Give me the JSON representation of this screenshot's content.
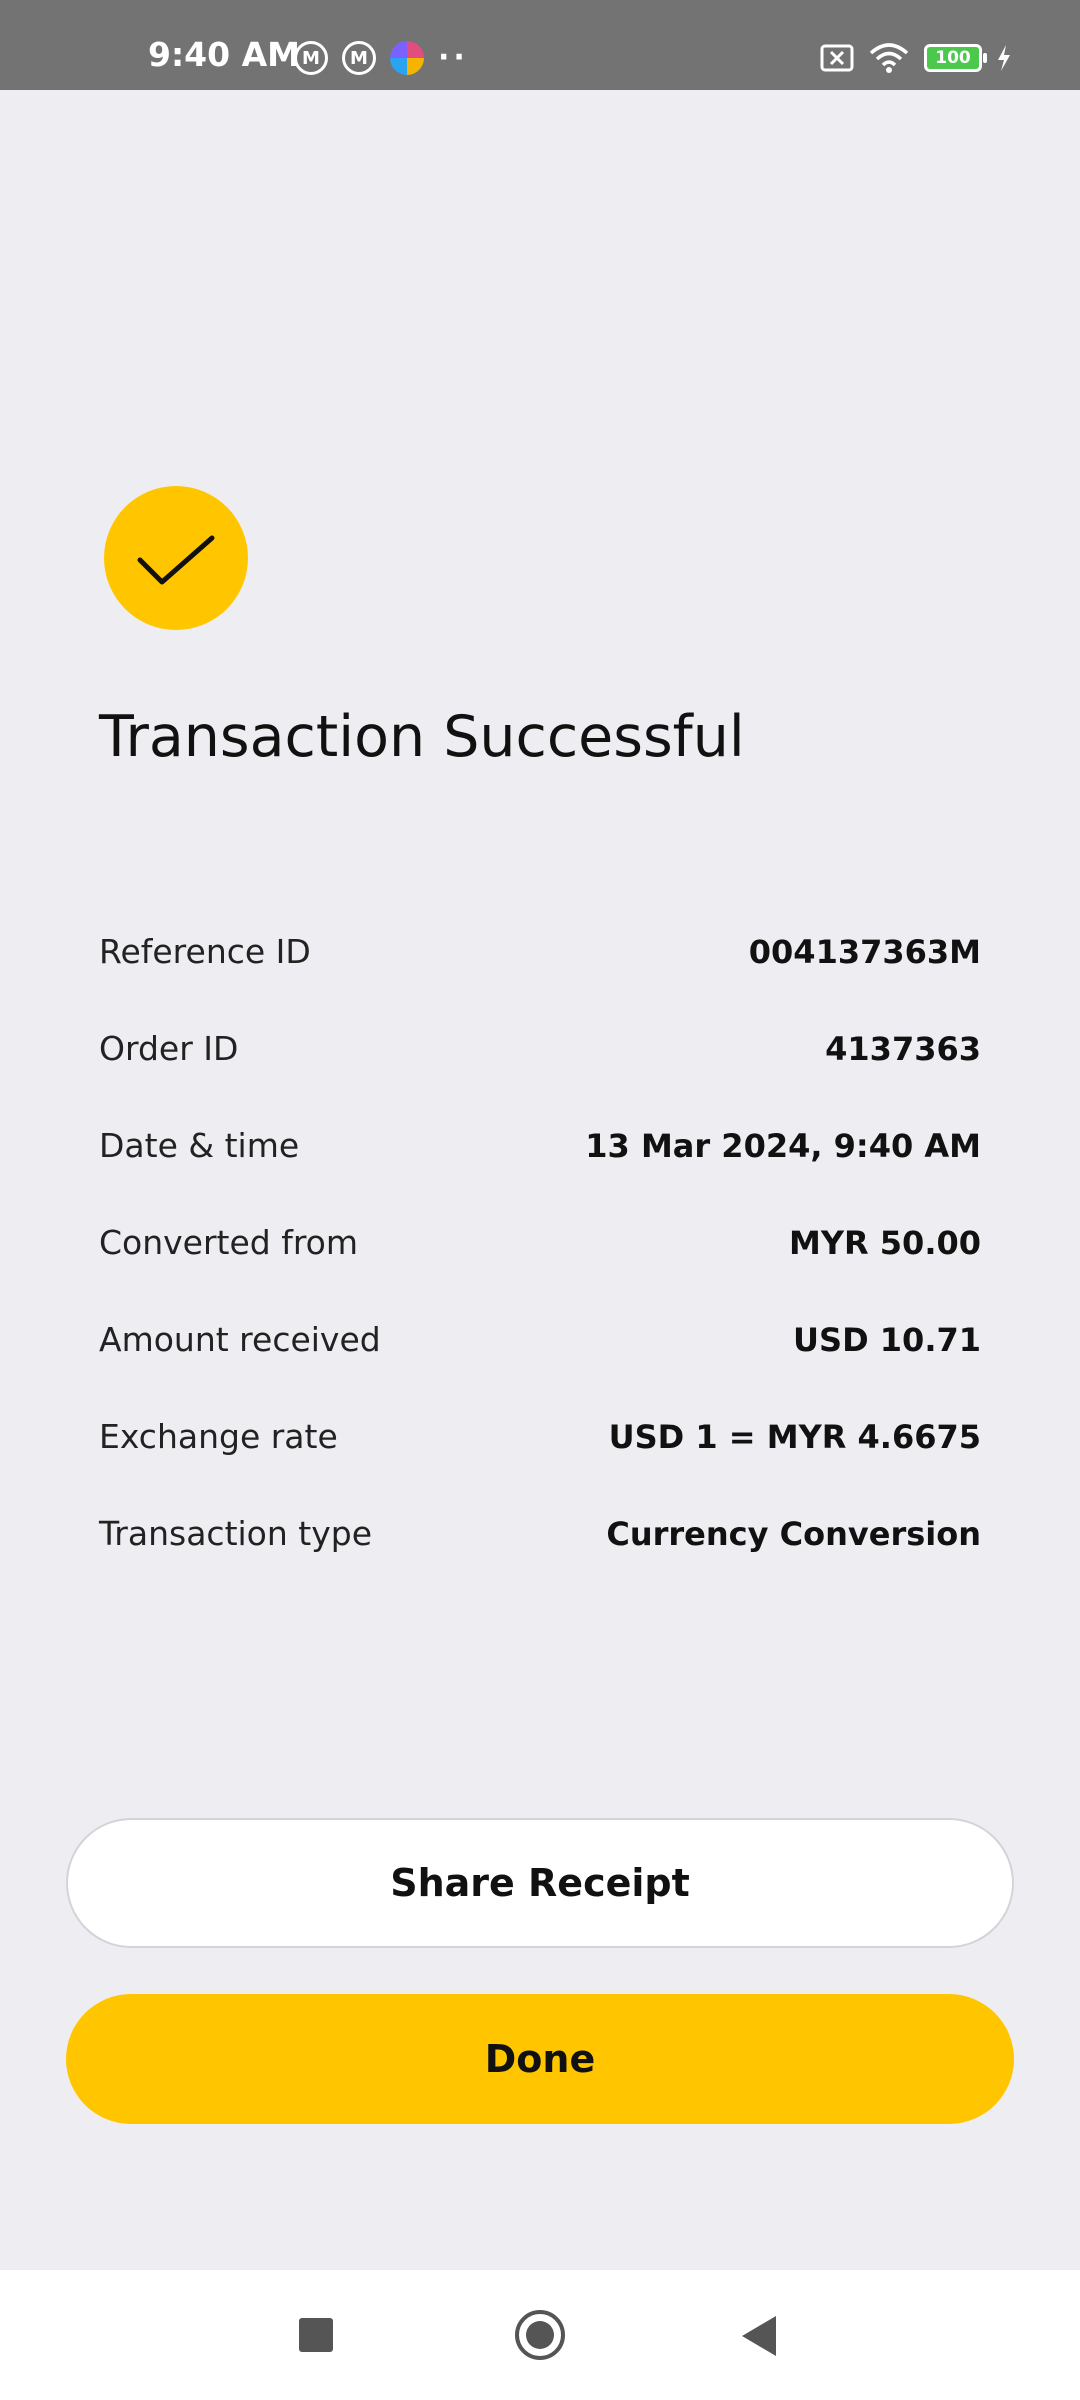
{
  "status_bar": {
    "time": "9:40 AM",
    "notification_icons": [
      "m-icon",
      "m-icon",
      "color-app-icon"
    ],
    "more_dots": "··",
    "battery_level": "100",
    "icons": [
      "sim-off-icon",
      "wifi-icon",
      "battery-icon",
      "charging-icon"
    ]
  },
  "result": {
    "icon": "check-icon",
    "title": "Transaction Successful"
  },
  "details": [
    {
      "label": "Reference ID",
      "value": "004137363M"
    },
    {
      "label": "Order ID",
      "value": "4137363"
    },
    {
      "label": "Date & time",
      "value": "13 Mar 2024, 9:40 AM"
    },
    {
      "label": "Converted from",
      "value": "MYR 50.00"
    },
    {
      "label": "Amount received",
      "value": "USD 10.71"
    },
    {
      "label": "Exchange rate",
      "value": "USD 1 = MYR 4.6675"
    },
    {
      "label": "Transaction type",
      "value": "Currency Conversion"
    }
  ],
  "actions": {
    "share_label": "Share Receipt",
    "done_label": "Done"
  },
  "colors": {
    "accent": "#ffc600",
    "background": "#eeeef2"
  },
  "nav_bar": {
    "icons": [
      "recent-apps-icon",
      "home-icon",
      "back-icon"
    ]
  }
}
